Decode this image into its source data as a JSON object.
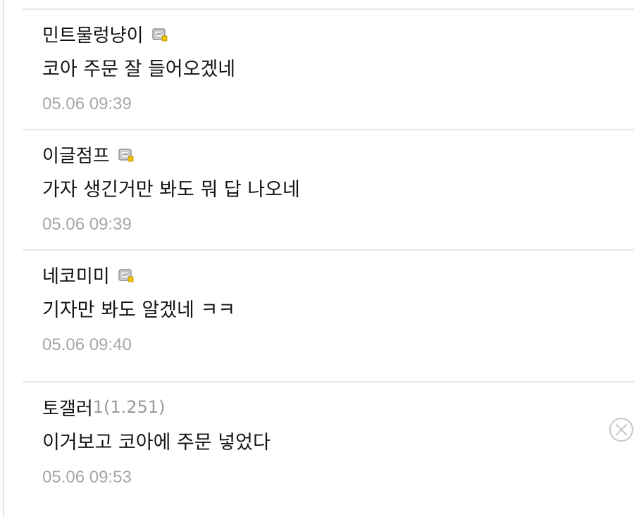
{
  "comments": [
    {
      "author": "민트물렁냥이",
      "author_meta": "",
      "has_badge": true,
      "text": "코아 주문 잘 들어오겠네",
      "time": "05.06 09:39"
    },
    {
      "author": "이글점프",
      "author_meta": "",
      "has_badge": true,
      "text": "가자 생긴거만 봐도 뭐 답 나오네",
      "time": "05.06 09:39"
    },
    {
      "author": "네코미미",
      "author_meta": "",
      "has_badge": true,
      "text": "기자만 봐도 알겠네 ㅋㅋ",
      "time": "05.06 09:40"
    },
    {
      "author": "토갤러",
      "author_meta": "1(1.251)",
      "has_badge": false,
      "text": "이거보고 코아에 주문 넣었다",
      "time": "05.06 09:53",
      "has_delete": true
    }
  ],
  "colors": {
    "divider": "#e6e6ef",
    "timestamp": "#a6a6a6",
    "badge_fill": "#d8d8d8",
    "badge_dot": "#f2c200"
  },
  "icons": {
    "badge": "mobile-badge-icon",
    "delete": "close-circle-icon"
  }
}
